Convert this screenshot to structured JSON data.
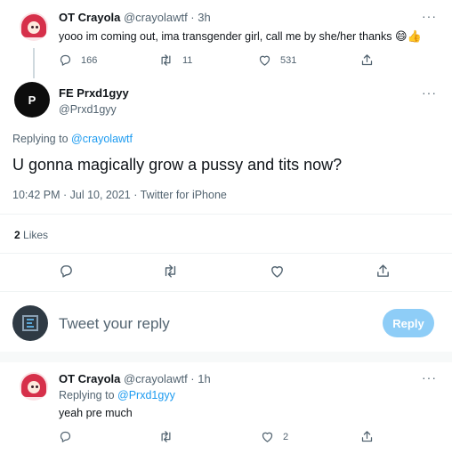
{
  "tweet1": {
    "name": "OT Crayola",
    "handle_time": "@crayolawtf · 3h",
    "text": "yooo im coming out, ima transgender girl, call me by she/her thanks",
    "emoji": "😄👍",
    "reply_count": "166",
    "retweet_count": "11",
    "like_count": "531",
    "more": "···"
  },
  "main_tweet": {
    "name": "FE Prxd1gyy",
    "handle": "@Prxd1gyy",
    "replying_prefix": "Replying to",
    "replying_to": "@crayolawtf",
    "text": "U gonna magically grow a pussy and tits now?",
    "timestamp": "10:42 PM · Jul 10, 2021 · Twitter for iPhone",
    "likes_count": "2",
    "likes_label": "Likes",
    "more": "···"
  },
  "composer": {
    "placeholder": "Tweet your reply",
    "button": "Reply",
    "accent": "#1d9bf0"
  },
  "reply_tweet": {
    "name": "OT Crayola",
    "handle_time": "@crayolawtf · 1h",
    "replying_prefix": "Replying to",
    "replying_to": "@Prxd1gyy",
    "text": "yeah pre much",
    "like_count": "2",
    "more": "···"
  }
}
